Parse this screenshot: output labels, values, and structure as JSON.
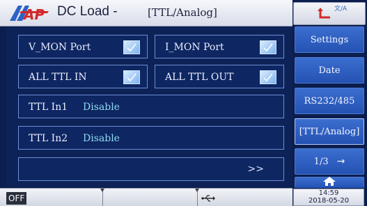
{
  "header": {
    "title": "DC Load -",
    "subtitle": "[TTL/Analog]",
    "language_glyphs": "文/A",
    "logo_text": "AP"
  },
  "panel": {
    "row1": [
      {
        "label": "V_MON Port",
        "checked": true
      },
      {
        "label": "I_MON Port",
        "checked": true
      }
    ],
    "row2": [
      {
        "label": "ALL TTL IN",
        "checked": true
      },
      {
        "label": "ALL TTL OUT",
        "checked": true
      }
    ],
    "ttl_in1": {
      "label": "TTL In1",
      "value": "Disable"
    },
    "ttl_in2": {
      "label": "TTL In2",
      "value": "Disable"
    },
    "more_label": ">>"
  },
  "sidebar": {
    "settings": "Settings",
    "date": "Date",
    "rs232": "RS232/485",
    "ttl_analog": "[TTL/Analog]",
    "page": "1/3",
    "page_arrow": "→",
    "home_icon": "home-icon"
  },
  "status_bar": {
    "output_state": "OFF",
    "usb_icon": "usb-icon",
    "time": "14:59",
    "date": "2018-05-20"
  },
  "colors": {
    "background": "#0b1e4d",
    "cell_border": "#6f8fd6",
    "value_text": "#8fdcf3",
    "sidebar_button": "#2b5cc0"
  }
}
